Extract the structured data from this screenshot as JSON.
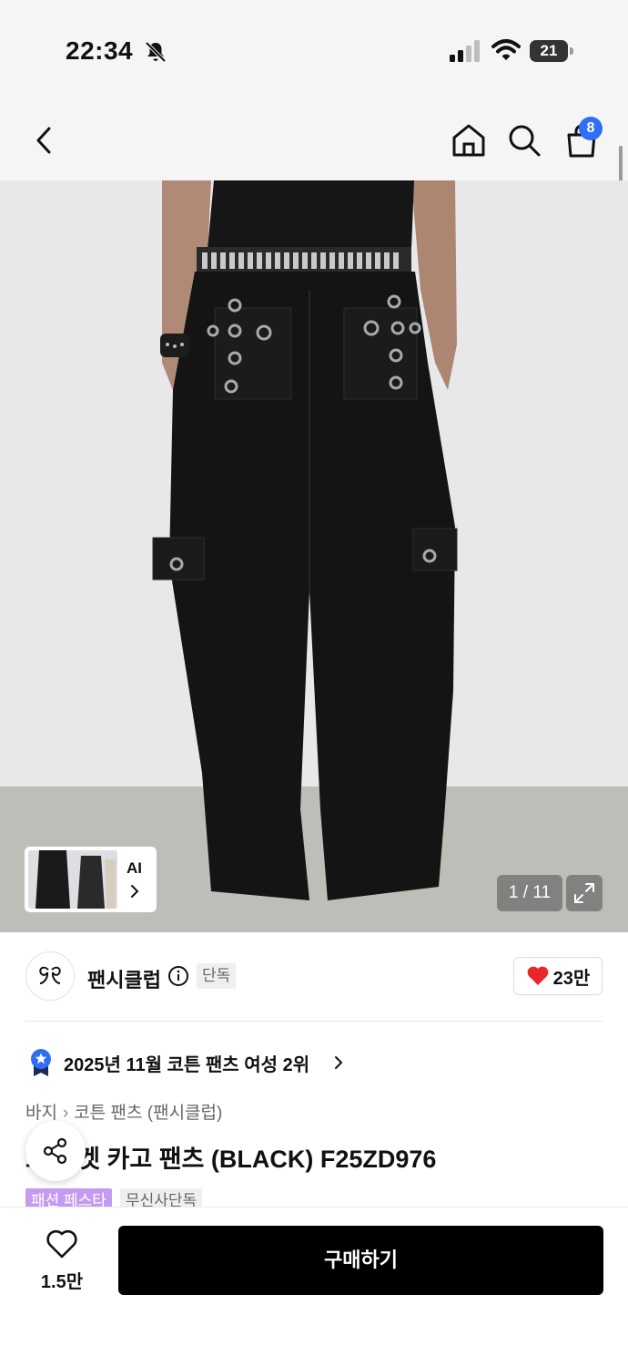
{
  "status_bar": {
    "time": "22:34",
    "battery": "21",
    "icons": [
      "bell-slash-icon",
      "signal-icon",
      "wifi-icon",
      "battery-icon"
    ]
  },
  "nav": {
    "icons": [
      "back-icon",
      "home-icon",
      "search-icon",
      "cart-icon"
    ],
    "cart_count": "8"
  },
  "gallery": {
    "ai_label": "AI",
    "counter": "1 / 11",
    "expand_icon": "expand-icon"
  },
  "brand": {
    "name": "팬시클럽",
    "badge": "단독",
    "likes": "23만",
    "heart_color": "#e8262b"
  },
  "ranking": {
    "text": "2025년 11월 코튼 팬츠 여성 2위"
  },
  "category": {
    "level1": "바지",
    "level2": "코튼 팬츠 (팬시클럽)"
  },
  "product": {
    "title": "포켓 카고 팬츠 (BLACK) F25ZD976",
    "title_prefix": "스"
  },
  "tags": [
    {
      "label": "패션 페스타",
      "color": "#c39bef"
    },
    {
      "label": "무신사단독"
    }
  ],
  "bottom": {
    "wish_count": "1.5만",
    "buy_label": "구매하기"
  },
  "colors": {
    "badge_blue": "#2f6ef5",
    "buy_black": "#000000"
  }
}
